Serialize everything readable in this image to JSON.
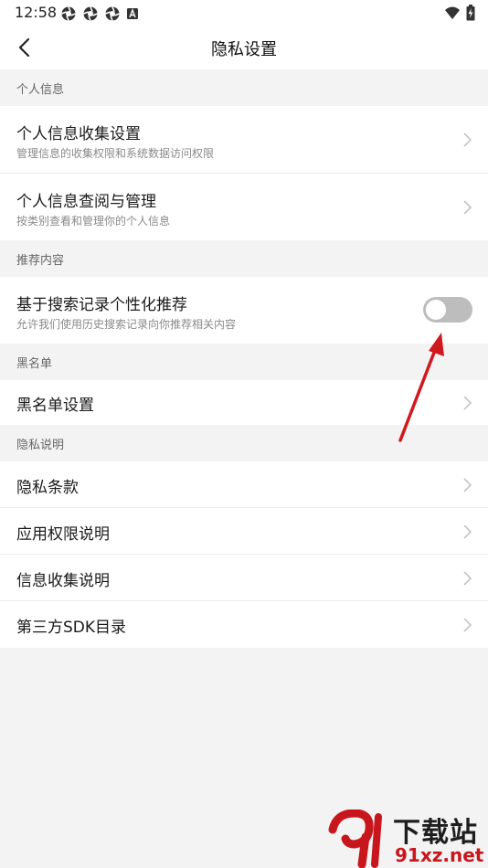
{
  "status_bar": {
    "time": "12:58"
  },
  "nav": {
    "title": "隐私设置"
  },
  "sections": {
    "personal": "个人信息",
    "recommend": "推荐内容",
    "blacklist": "黑名单",
    "privacy": "隐私说明"
  },
  "rows": {
    "collect_title": "个人信息收集设置",
    "collect_sub": "管理信息的收集权限和系统数据访问权限",
    "view_title": "个人信息查阅与管理",
    "view_sub": "按类别查看和管理你的个人信息",
    "personalized_title": "基于搜索记录个性化推荐",
    "personalized_sub": "允许我们使用历史搜索记录向你推荐相关内容",
    "blacklist_title": "黑名单设置",
    "terms_title": "隐私条款",
    "permissions_title": "应用权限说明",
    "collection_desc_title": "信息收集说明",
    "sdk_title": "第三方SDK目录"
  },
  "toggle": {
    "personalized_on": false
  },
  "colors": {
    "annotation_arrow": "#d0191f",
    "toggle_off": "#bdbdbd"
  },
  "watermark": {
    "text": "下载站",
    "url": "91xz.net"
  }
}
